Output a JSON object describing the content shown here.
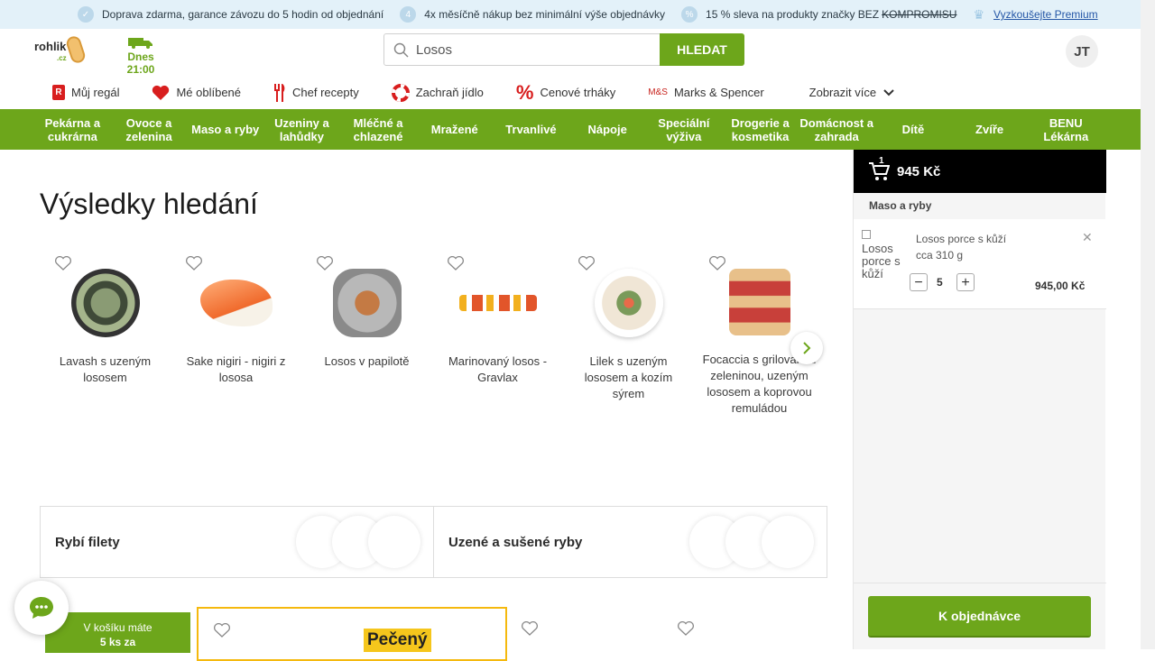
{
  "promo": {
    "item1": "Doprava zdarma, garance závozu do 5 hodin od objednání",
    "item2": "4x měsíčně nákup bez minimální výše objednávky",
    "item3": "15 % sleva na produkty značky BEZ",
    "item3_strike": "KOMPROMISU",
    "item4": "Vyzkoušejte Premium"
  },
  "header": {
    "logo": "rohlik",
    "logo_cz": ".cz",
    "delivery_time": "Dnes 21:00",
    "search_value": "Losos",
    "search_button": "HLEDAT",
    "avatar": "JT"
  },
  "quicknav": [
    {
      "label": "Můj regál"
    },
    {
      "label": "Mé oblíbené"
    },
    {
      "label": "Chef recepty"
    },
    {
      "label": "Zachraň jídlo"
    },
    {
      "label": "Cenové trháky"
    },
    {
      "label": "Marks & Spencer",
      "icon_text": "M&S"
    },
    {
      "label": "Zobrazit více"
    }
  ],
  "categories": [
    "Pekárna a cukrárna",
    "Ovoce a zelenina",
    "Maso a ryby",
    "Uzeniny a lahůdky",
    "Mléčné a chlazené",
    "Mražené",
    "Trvanlivé",
    "Nápoje",
    "Speciální výživa",
    "Drogerie a kosmetika",
    "Domácnost a zahrada",
    "Dítě",
    "Zvíře",
    "BENU Lékárna"
  ],
  "main": {
    "title": "Výsledky hledání",
    "products": [
      {
        "name": "Lavash s uzeným lososem",
        "color": "#5a6a4e"
      },
      {
        "name": "Sake nigiri - nigiri z lososa",
        "color": "#f07a3c"
      },
      {
        "name": "Losos v papilotě",
        "color": "#a9a9a9"
      },
      {
        "name": "Marinovaný losos - Gravlax",
        "color": "#e2652f"
      },
      {
        "name": "Lilek s uzeným lososem a kozím sýrem",
        "color": "#d9d9d9"
      },
      {
        "name": "Focaccia s grilovanou zeleninou, uzeným lososem a koprovou remuládou",
        "color": "#c86a4a"
      }
    ],
    "category_boxes": [
      "Rybí filety",
      "Uzené a sušené ryby"
    ],
    "in_cart_line1": "V košíku máte",
    "in_cart_line2": "5 ks za",
    "badge": "Pečený"
  },
  "cart": {
    "count": "1",
    "total": "945 Kč",
    "section": "Maso a ryby",
    "item": {
      "img_alt": "Losos porce s kůží",
      "name": "Losos porce s kůží",
      "weight": "cca 310 g",
      "qty": "5",
      "price": "945,00 Kč"
    },
    "order_button": "K objednávce"
  },
  "colors": {
    "brand_green": "#6da61b",
    "promo_bg": "#e3f1f9",
    "accent_red": "#d81e1e"
  }
}
